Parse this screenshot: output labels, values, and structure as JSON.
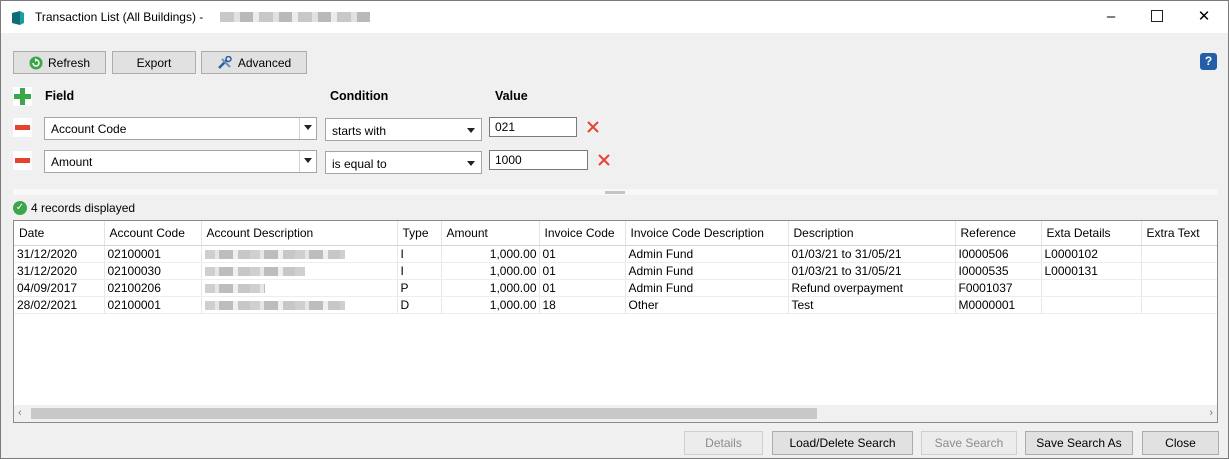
{
  "window": {
    "title": "Transaction List (All Buildings)",
    "title_separator": "-",
    "minimize": "–",
    "close": "✕"
  },
  "toolbar": {
    "refresh_label": "Refresh",
    "export_label": "Export",
    "advanced_label": "Advanced",
    "help_label": "?"
  },
  "filters": {
    "headers": {
      "field": "Field",
      "condition": "Condition",
      "value": "Value"
    },
    "rows": [
      {
        "field": "Account Code",
        "condition": "starts with",
        "value": "021"
      },
      {
        "field": "Amount",
        "condition": "is equal to",
        "value": "1000"
      }
    ]
  },
  "status": {
    "text": "4 records displayed"
  },
  "grid": {
    "columns": [
      "Date",
      "Account Code",
      "Account Description",
      "Type",
      "Amount",
      "Invoice Code",
      "Invoice Code Description",
      "Description",
      "Reference",
      "Exta Details",
      "Extra Text"
    ],
    "rows": [
      {
        "date": "31/12/2020",
        "account_code": "02100001",
        "type": "I",
        "amount": "1,000.00",
        "invoice_code": "01",
        "invoice_desc": "Admin Fund",
        "description": "01/03/21 to 31/05/21",
        "reference": "I0000506",
        "extra_details": "L0000102",
        "extra_text": ""
      },
      {
        "date": "31/12/2020",
        "account_code": "02100030",
        "type": "I",
        "amount": "1,000.00",
        "invoice_code": "01",
        "invoice_desc": "Admin Fund",
        "description": "01/03/21 to 31/05/21",
        "reference": "I0000535",
        "extra_details": "L0000131",
        "extra_text": ""
      },
      {
        "date": "04/09/2017",
        "account_code": "02100206",
        "type": "P",
        "amount": "1,000.00",
        "invoice_code": "01",
        "invoice_desc": "Admin Fund",
        "description": "Refund overpayment",
        "reference": "F0001037",
        "extra_details": "",
        "extra_text": ""
      },
      {
        "date": "28/02/2021",
        "account_code": "02100001",
        "type": "D",
        "amount": "1,000.00",
        "invoice_code": "18",
        "invoice_desc": "Other",
        "description": "Test",
        "reference": "M0000001",
        "extra_details": "",
        "extra_text": ""
      }
    ]
  },
  "footer": {
    "details_label": "Details",
    "load_delete_label": "Load/Delete Search",
    "save_search_label": "Save Search",
    "save_search_as_label": "Save Search As",
    "close_label": "Close"
  },
  "colors": {
    "accent_green": "#3ba64a",
    "remove_red": "#e8422f",
    "help_blue": "#245ea8"
  }
}
